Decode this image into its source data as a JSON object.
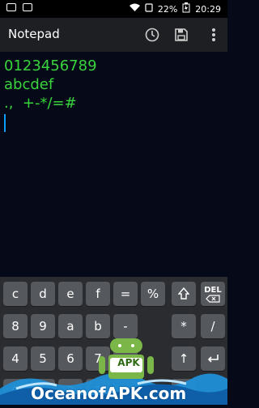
{
  "statusbar": {
    "battery_percent": "22%",
    "time": "20:29"
  },
  "appbar": {
    "title": "Notepad",
    "icons": [
      "history-icon",
      "save-icon",
      "more-vert-icon"
    ]
  },
  "editor": {
    "lines": [
      "0123456789",
      "abcdef",
      ".,  +-*/=#"
    ]
  },
  "keyboard": {
    "rows": [
      [
        "c",
        "d",
        "e",
        "f",
        "=",
        "%",
        "⇧",
        "DEL"
      ],
      [
        "8",
        "9",
        "a",
        "b",
        "-",
        "*",
        "/",
        ""
      ],
      [
        "4",
        "5",
        "6",
        "7",
        "+",
        "",
        "↑",
        "↵"
      ],
      [
        "0",
        "1",
        "2",
        "3",
        ".",
        "",
        "↓",
        ""
      ]
    ]
  },
  "watermark": {
    "text": "OceanofAPK.com",
    "badge": "APK"
  }
}
